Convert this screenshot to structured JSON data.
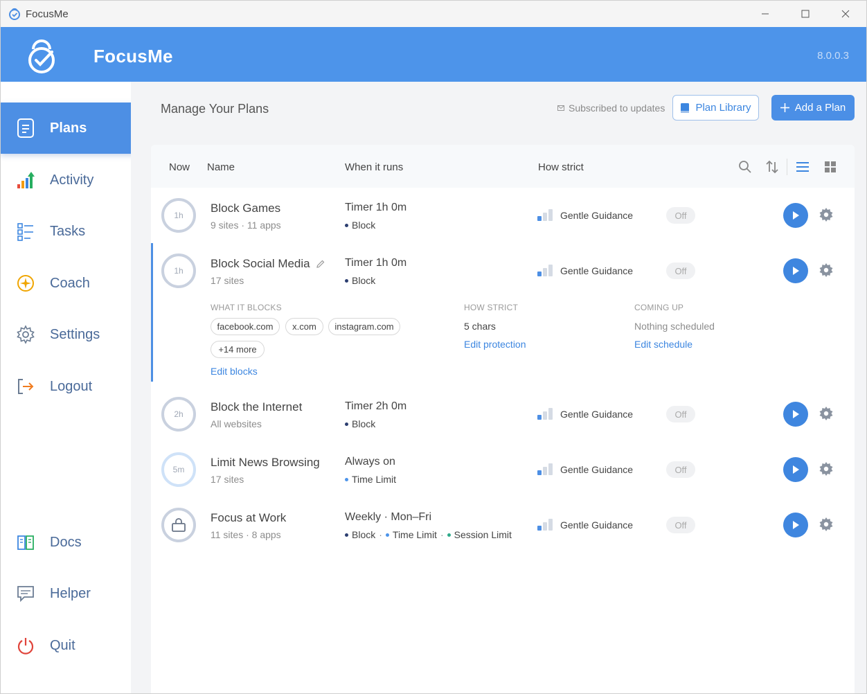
{
  "window": {
    "title": "FocusMe"
  },
  "header": {
    "brand": "FocusMe",
    "version": "8.0.0.3"
  },
  "sidebar": {
    "items": [
      {
        "label": "Plans",
        "icon": "plans-icon",
        "active": true
      },
      {
        "label": "Activity",
        "icon": "activity-icon"
      },
      {
        "label": "Tasks",
        "icon": "tasks-icon"
      },
      {
        "label": "Coach",
        "icon": "coach-icon"
      },
      {
        "label": "Settings",
        "icon": "settings-icon"
      },
      {
        "label": "Logout",
        "icon": "logout-icon"
      },
      {
        "label": "Docs",
        "icon": "docs-icon"
      },
      {
        "label": "Helper",
        "icon": "helper-icon"
      },
      {
        "label": "Quit",
        "icon": "quit-icon"
      }
    ]
  },
  "main": {
    "title": "Manage Your Plans",
    "subscribed": "Subscribed to updates",
    "plan_library": "Plan Library",
    "add_plan": "Add a Plan"
  },
  "table": {
    "headers": {
      "now": "Now",
      "name": "Name",
      "when": "When it runs",
      "strict": "How strict"
    },
    "rows": [
      {
        "ring": "1h",
        "name": "Block Games",
        "sub": "9 sites · 11 apps",
        "when": "Timer 1h 0m",
        "tags": [
          "Block"
        ],
        "strict": "Gentle Guidance",
        "status": "Off"
      },
      {
        "ring": "1h",
        "name": "Block Social Media",
        "sub": "17 sites",
        "when": "Timer 1h 0m",
        "tags": [
          "Block"
        ],
        "strict": "Gentle Guidance",
        "status": "Off",
        "details": {
          "blocks_label": "WHAT IT BLOCKS",
          "chips": [
            "facebook.com",
            "x.com",
            "instagram.com",
            "+14 more"
          ],
          "edit_blocks": "Edit blocks",
          "strict_label": "HOW STRICT",
          "strict_value": "5 chars",
          "edit_protection": "Edit protection",
          "coming_label": "COMING UP",
          "coming_value": "Nothing scheduled",
          "edit_schedule": "Edit schedule"
        }
      },
      {
        "ring": "2h",
        "name": "Block the Internet",
        "sub": "All websites",
        "when": "Timer 2h 0m",
        "tags": [
          "Block"
        ],
        "strict": "Gentle Guidance",
        "status": "Off"
      },
      {
        "ring": "5m",
        "name": "Limit News Browsing",
        "sub": "17 sites",
        "when": "Always on",
        "tags": [
          "Time Limit"
        ],
        "strict": "Gentle Guidance",
        "status": "Off"
      },
      {
        "ring": "",
        "name": "Focus at Work",
        "sub": "11 sites · 8 apps",
        "when": "Weekly · Mon–Fri",
        "tags": [
          "Block",
          "Time Limit",
          "Session Limit"
        ],
        "strict": "Gentle Guidance",
        "status": "Off"
      }
    ]
  },
  "colors": {
    "accent": "#4d94ea",
    "block": "#2c3e70",
    "time_limit": "#4d94ea",
    "session_limit": "#2eaa8a"
  }
}
